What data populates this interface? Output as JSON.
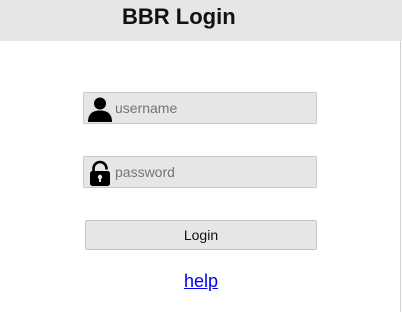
{
  "header": {
    "title": "BBR Login"
  },
  "form": {
    "username": {
      "placeholder": "username",
      "value": "",
      "icon": "user-icon"
    },
    "password": {
      "placeholder": "password",
      "value": "",
      "icon": "lock-icon"
    },
    "login_label": "Login",
    "help_label": "help"
  },
  "colors": {
    "header_bg": "#e6e6e6",
    "field_bg": "#e6e6e6",
    "link": "#0000ee"
  }
}
